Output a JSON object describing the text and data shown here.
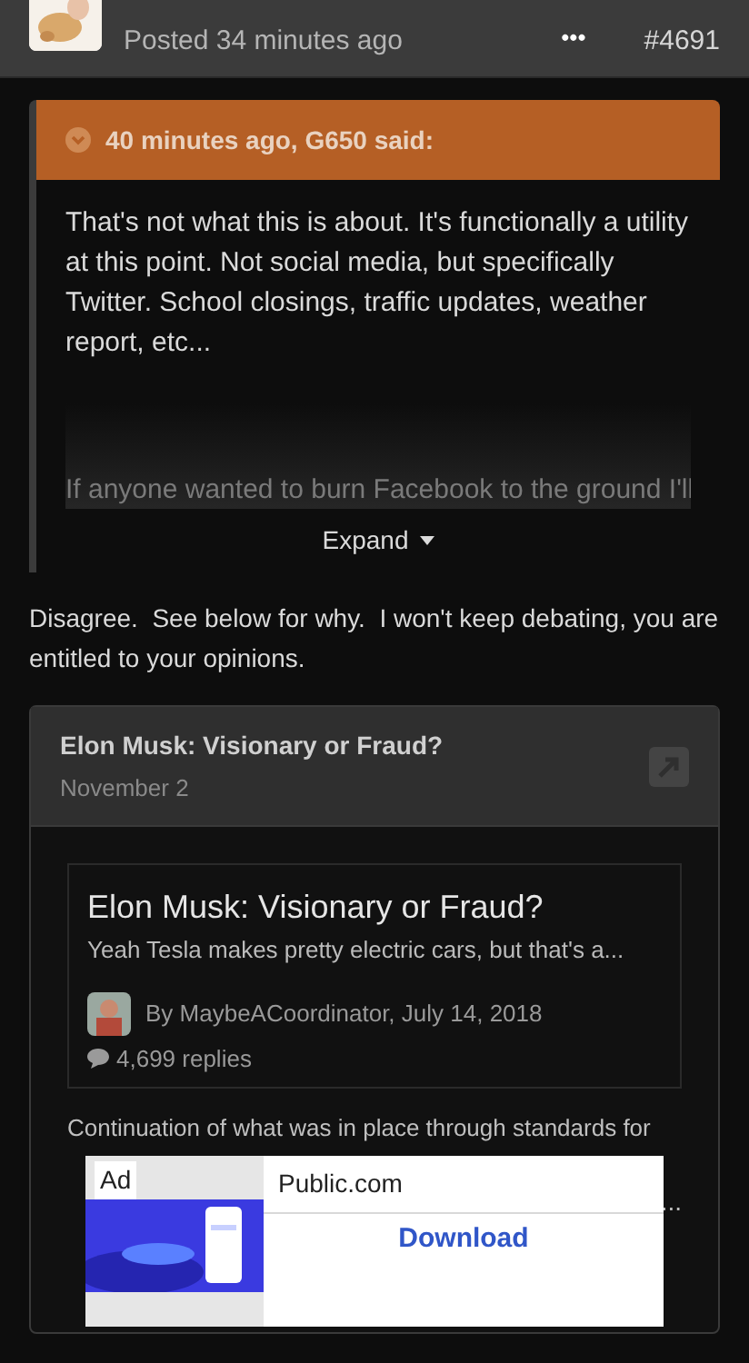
{
  "post_header": {
    "posted": "Posted 34 minutes ago",
    "more": "•••",
    "post_number": "#4691"
  },
  "quote": {
    "attribution": "40 minutes ago, G650 said:",
    "text": "That's not what this is about. It's functionally a utility at this point. Not social media, but specifically Twitter. School closings, traffic updates, weather report, etc...",
    "faded_text": "If anyone wanted to burn Facebook to the ground I'll",
    "expand": "Expand"
  },
  "reply": "Disagree.  See below for why.  I won't keep debating, you are entitled to your opinions.",
  "embed": {
    "title": "Elon Musk: Visionary or Fraud?",
    "date": "November 2",
    "topic": {
      "title": "Elon Musk: Visionary or Fraud?",
      "snippet": "Yeah Tesla makes pretty electric cars, but that's a...",
      "byline": "By MaybeACoordinator, July 14, 2018",
      "replies": "4,699 replies"
    },
    "excerpt": "Continuation of what was in place through standards for",
    "excerpt_end": "..."
  },
  "ad": {
    "badge": "Ad",
    "advertiser": "Public.com",
    "cta": "Download"
  }
}
